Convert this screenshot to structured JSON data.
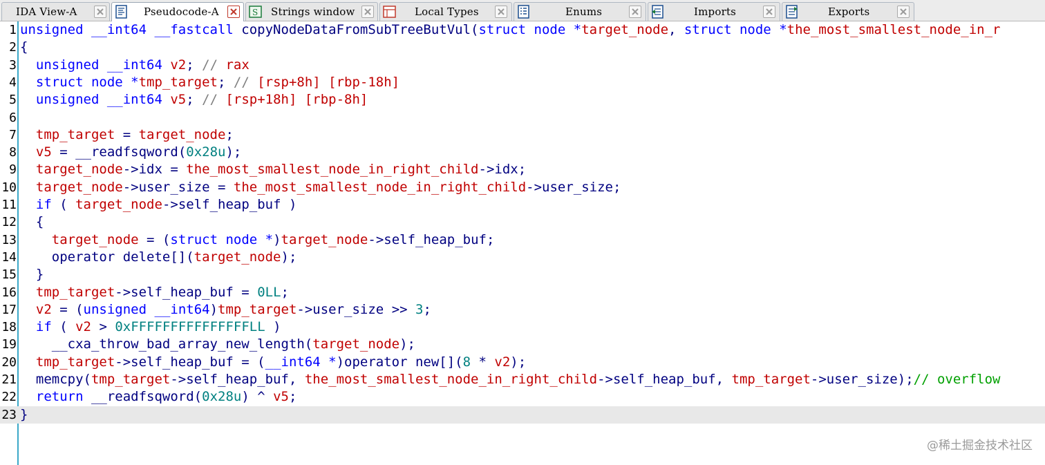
{
  "tabs": [
    {
      "label": "IDA View-A",
      "icon": "graph-view-icon",
      "active": false
    },
    {
      "label": "Pseudocode-A",
      "icon": "pseudocode-icon",
      "active": true
    },
    {
      "label": "Strings window",
      "icon": "strings-icon",
      "active": false
    },
    {
      "label": "Local Types",
      "icon": "local-types-icon",
      "active": false
    },
    {
      "label": "Enums",
      "icon": "enums-icon",
      "active": false
    },
    {
      "label": "Imports",
      "icon": "imports-icon",
      "active": false
    },
    {
      "label": "Exports",
      "icon": "exports-icon",
      "active": false
    }
  ],
  "colors": {
    "keyword": "#0000ff",
    "variable": "#c00000",
    "identifier": "#000080",
    "comment": "#00a000",
    "number": "#008080",
    "gutter": "#3aa8c8"
  },
  "code": {
    "current_line": 23,
    "lines": [
      {
        "n": "1",
        "tokens": [
          [
            "kw",
            "unsigned __int64 __fastcall "
          ],
          [
            "id",
            "copyNodeDataFromSubTreeButVul("
          ],
          [
            "kw",
            "struct node *"
          ],
          [
            "var",
            "target_node"
          ],
          [
            "id",
            ", "
          ],
          [
            "kw",
            "struct node *"
          ],
          [
            "var",
            "the_most_smallest_node_in_r"
          ]
        ]
      },
      {
        "n": "2",
        "tokens": [
          [
            "id",
            "{"
          ]
        ]
      },
      {
        "n": "3",
        "tokens": [
          [
            "id",
            "  "
          ],
          [
            "kw",
            "unsigned __int64 "
          ],
          [
            "var",
            "v2"
          ],
          [
            "id",
            "; "
          ],
          [
            "gray",
            "// "
          ],
          [
            "var",
            "rax"
          ]
        ]
      },
      {
        "n": "4",
        "tokens": [
          [
            "id",
            "  "
          ],
          [
            "kw",
            "struct node *"
          ],
          [
            "var",
            "tmp_target"
          ],
          [
            "id",
            "; "
          ],
          [
            "gray",
            "// "
          ],
          [
            "var",
            "[rsp+8h] [rbp-18h]"
          ]
        ]
      },
      {
        "n": "5",
        "tokens": [
          [
            "id",
            "  "
          ],
          [
            "kw",
            "unsigned __int64 "
          ],
          [
            "var",
            "v5"
          ],
          [
            "id",
            "; "
          ],
          [
            "gray",
            "// "
          ],
          [
            "var",
            "[rsp+18h] [rbp-8h]"
          ]
        ]
      },
      {
        "n": "6",
        "tokens": [
          [
            "id",
            ""
          ]
        ]
      },
      {
        "n": "7",
        "tokens": [
          [
            "id",
            "  "
          ],
          [
            "var",
            "tmp_target"
          ],
          [
            "id",
            " = "
          ],
          [
            "var",
            "target_node"
          ],
          [
            "id",
            ";"
          ]
        ]
      },
      {
        "n": "8",
        "tokens": [
          [
            "id",
            "  "
          ],
          [
            "var",
            "v5"
          ],
          [
            "id",
            " = "
          ],
          [
            "id",
            "__readfsqword("
          ],
          [
            "num",
            "0x28u"
          ],
          [
            "id",
            ");"
          ]
        ]
      },
      {
        "n": "9",
        "tokens": [
          [
            "id",
            "  "
          ],
          [
            "var",
            "target_node"
          ],
          [
            "id",
            "->idx = "
          ],
          [
            "var",
            "the_most_smallest_node_in_right_child"
          ],
          [
            "id",
            "->idx;"
          ]
        ]
      },
      {
        "n": "10",
        "tokens": [
          [
            "id",
            "  "
          ],
          [
            "var",
            "target_node"
          ],
          [
            "id",
            "->user_size = "
          ],
          [
            "var",
            "the_most_smallest_node_in_right_child"
          ],
          [
            "id",
            "->user_size;"
          ]
        ]
      },
      {
        "n": "11",
        "tokens": [
          [
            "id",
            "  "
          ],
          [
            "kw",
            "if"
          ],
          [
            "id",
            " ( "
          ],
          [
            "var",
            "target_node"
          ],
          [
            "id",
            "->self_heap_buf )"
          ]
        ]
      },
      {
        "n": "12",
        "tokens": [
          [
            "id",
            "  {"
          ]
        ]
      },
      {
        "n": "13",
        "tokens": [
          [
            "id",
            "    "
          ],
          [
            "var",
            "target_node"
          ],
          [
            "id",
            " = ("
          ],
          [
            "kw",
            "struct node *"
          ],
          [
            "id",
            ")"
          ],
          [
            "var",
            "target_node"
          ],
          [
            "id",
            "->self_heap_buf;"
          ]
        ]
      },
      {
        "n": "14",
        "tokens": [
          [
            "id",
            "    operator delete[]("
          ],
          [
            "var",
            "target_node"
          ],
          [
            "id",
            ");"
          ]
        ]
      },
      {
        "n": "15",
        "tokens": [
          [
            "id",
            "  }"
          ]
        ]
      },
      {
        "n": "16",
        "tokens": [
          [
            "id",
            "  "
          ],
          [
            "var",
            "tmp_target"
          ],
          [
            "id",
            "->self_heap_buf = "
          ],
          [
            "num",
            "0LL"
          ],
          [
            "id",
            ";"
          ]
        ]
      },
      {
        "n": "17",
        "tokens": [
          [
            "id",
            "  "
          ],
          [
            "var",
            "v2"
          ],
          [
            "id",
            " = ("
          ],
          [
            "kw",
            "unsigned __int64"
          ],
          [
            "id",
            ")"
          ],
          [
            "var",
            "tmp_target"
          ],
          [
            "id",
            "->user_size >> "
          ],
          [
            "num",
            "3"
          ],
          [
            "id",
            ";"
          ]
        ]
      },
      {
        "n": "18",
        "tokens": [
          [
            "id",
            "  "
          ],
          [
            "kw",
            "if"
          ],
          [
            "id",
            " ( "
          ],
          [
            "var",
            "v2"
          ],
          [
            "id",
            " > "
          ],
          [
            "num",
            "0xFFFFFFFFFFFFFFFLL"
          ],
          [
            "id",
            " )"
          ]
        ]
      },
      {
        "n": "19",
        "tokens": [
          [
            "id",
            "    __cxa_throw_bad_array_new_length("
          ],
          [
            "var",
            "target_node"
          ],
          [
            "id",
            ");"
          ]
        ]
      },
      {
        "n": "20",
        "tokens": [
          [
            "id",
            "  "
          ],
          [
            "var",
            "tmp_target"
          ],
          [
            "id",
            "->self_heap_buf = ("
          ],
          [
            "kw",
            "__int64 *"
          ],
          [
            "id",
            ")operator new[]("
          ],
          [
            "num",
            "8"
          ],
          [
            "id",
            " * "
          ],
          [
            "var",
            "v2"
          ],
          [
            "id",
            ");"
          ]
        ]
      },
      {
        "n": "21",
        "tokens": [
          [
            "id",
            "  memcpy("
          ],
          [
            "var",
            "tmp_target"
          ],
          [
            "id",
            "->self_heap_buf, "
          ],
          [
            "var",
            "the_most_smallest_node_in_right_child"
          ],
          [
            "id",
            "->self_heap_buf, "
          ],
          [
            "var",
            "tmp_target"
          ],
          [
            "id",
            "->user_size);"
          ],
          [
            "cmt",
            "// overflow"
          ]
        ]
      },
      {
        "n": "22",
        "tokens": [
          [
            "id",
            "  "
          ],
          [
            "kw",
            "return"
          ],
          [
            "id",
            " __readfsqword("
          ],
          [
            "num",
            "0x28u"
          ],
          [
            "id",
            ") ^ "
          ],
          [
            "var",
            "v5"
          ],
          [
            "id",
            ";"
          ]
        ]
      },
      {
        "n": "23",
        "tokens": [
          [
            "id",
            "}"
          ]
        ]
      }
    ]
  },
  "watermark": "@稀土掘金技术社区"
}
